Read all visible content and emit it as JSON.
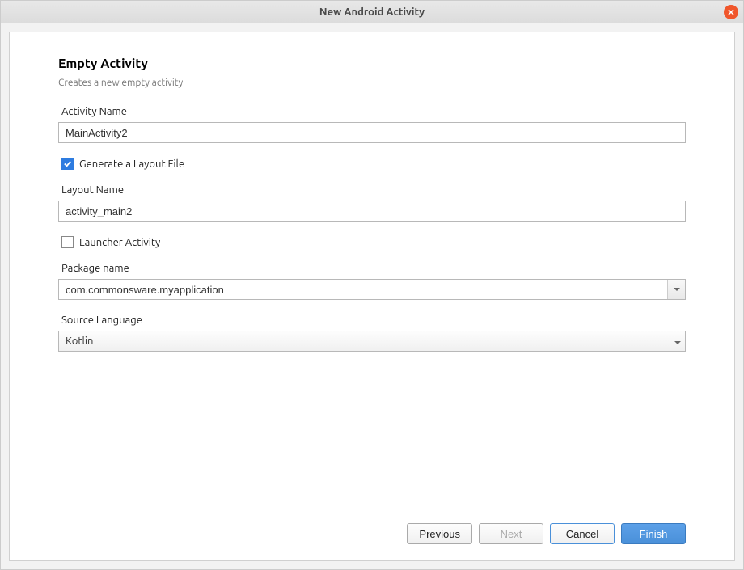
{
  "window": {
    "title": "New Android Activity"
  },
  "header": {
    "title": "Empty Activity",
    "subtitle": "Creates a new empty activity"
  },
  "fields": {
    "activityName": {
      "label": "Activity Name",
      "value": "MainActivity2"
    },
    "generateLayout": {
      "label": "Generate a Layout File",
      "checked": true
    },
    "layoutName": {
      "label": "Layout Name",
      "value": "activity_main2"
    },
    "launcher": {
      "label": "Launcher Activity",
      "checked": false
    },
    "packageName": {
      "label": "Package name",
      "value": "com.commonsware.myapplication"
    },
    "sourceLanguage": {
      "label": "Source Language",
      "value": "Kotlin"
    }
  },
  "buttons": {
    "previous": "Previous",
    "next": "Next",
    "cancel": "Cancel",
    "finish": "Finish"
  }
}
